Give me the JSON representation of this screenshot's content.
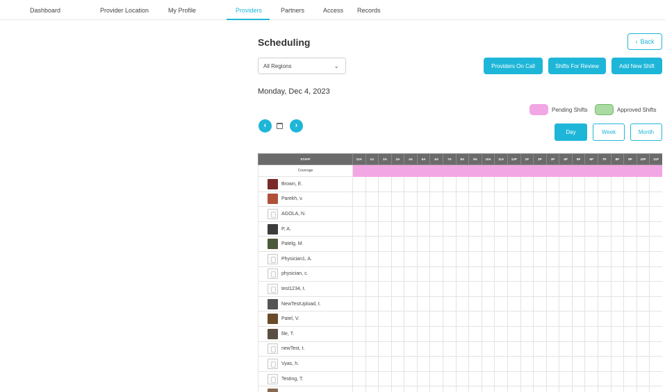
{
  "nav": {
    "items": [
      {
        "label": "Dashboard",
        "active": false
      },
      {
        "label": "Provider Location",
        "active": false
      },
      {
        "label": "My Profile",
        "active": false
      },
      {
        "label": "Providers",
        "active": true
      },
      {
        "label": "Partners",
        "active": false
      },
      {
        "label": "Access",
        "active": false
      },
      {
        "label": "Records",
        "active": false
      }
    ]
  },
  "page": {
    "title": "Scheduling",
    "back_label": "Back",
    "region_select": {
      "value": "All Regions"
    },
    "buttons": {
      "on_call": "Providers On Call",
      "review": "Shifts For Review",
      "add": "Add New Shift"
    },
    "date": "Monday, Dec 4, 2023",
    "legend": {
      "pending": "Pending Shifts",
      "approved": "Approved Shifts"
    },
    "views": {
      "day": "Day",
      "week": "Week",
      "month": "Month"
    }
  },
  "colors": {
    "accent": "#1eb6d8",
    "pending": "#f2a6e3",
    "approved": "#a9dba2",
    "header_bg": "#6b6b6b"
  },
  "grid": {
    "staff_header": "STAFF",
    "hours": [
      "12A",
      "1A",
      "2A",
      "3A",
      "4A",
      "5A",
      "6A",
      "7A",
      "8A",
      "9A",
      "10A",
      "11A",
      "12P",
      "1P",
      "2P",
      "3P",
      "4P",
      "5P",
      "6P",
      "7P",
      "8P",
      "9P",
      "10P",
      "11P"
    ],
    "coverage_label": "Coverage",
    "staff": [
      {
        "name": "Brown, E.",
        "avatar": "photo",
        "avatar_color": "#7a2a2a"
      },
      {
        "name": "Parekh, v.",
        "avatar": "photo",
        "avatar_color": "#b0503a"
      },
      {
        "name": "AGOLA, N.",
        "avatar": "blank"
      },
      {
        "name": "P, A.",
        "avatar": "photo",
        "avatar_color": "#3c3c3c"
      },
      {
        "name": "Patelg, M.",
        "avatar": "photo",
        "avatar_color": "#4a5a3a"
      },
      {
        "name": "Physician1, A.",
        "avatar": "blank"
      },
      {
        "name": "physician, c.",
        "avatar": "blank"
      },
      {
        "name": "test1234, t.",
        "avatar": "blank"
      },
      {
        "name": "NewTestUpload, t.",
        "avatar": "photo",
        "avatar_color": "#555555"
      },
      {
        "name": "Patel, V.",
        "avatar": "photo",
        "avatar_color": "#6b4a2a"
      },
      {
        "name": "file, T.",
        "avatar": "photo",
        "avatar_color": "#5a4e40"
      },
      {
        "name": "newTest, t.",
        "avatar": "blank"
      },
      {
        "name": "Vyas, h.",
        "avatar": "blank"
      },
      {
        "name": "Testing, T.",
        "avatar": "blank"
      },
      {
        "name": "",
        "avatar": "photo",
        "avatar_color": "#8a6a50"
      }
    ]
  }
}
